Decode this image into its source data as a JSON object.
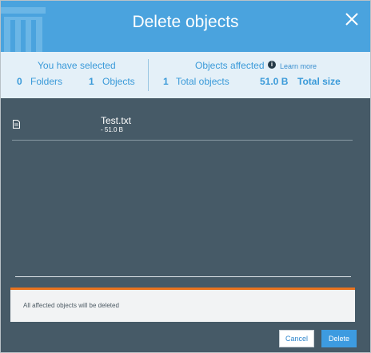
{
  "dialog": {
    "title": "Delete objects"
  },
  "summary": {
    "selected_title": "You have selected",
    "folders_count": "0",
    "folders_label": "Folders",
    "objects_count": "1",
    "objects_label": "Objects",
    "affected_title": "Objects affected",
    "learn_more": "Learn more",
    "total_count": "1",
    "total_label": "Total objects",
    "size_value": "51.0 B",
    "size_label": "Total size"
  },
  "objects": [
    {
      "name": "Test.txt",
      "size": "- 51.0 B",
      "icon": "file-icon"
    }
  ],
  "warning": {
    "text": "All affected objects will be deleted"
  },
  "buttons": {
    "cancel": "Cancel",
    "delete": "Delete"
  },
  "colors": {
    "header": "#4aa3de",
    "summary_bg": "#e4f0f8",
    "body_bg": "#465a67",
    "accent_text": "#3a9ad9",
    "warning": "#e8731f",
    "primary_button": "#3d9be0"
  }
}
